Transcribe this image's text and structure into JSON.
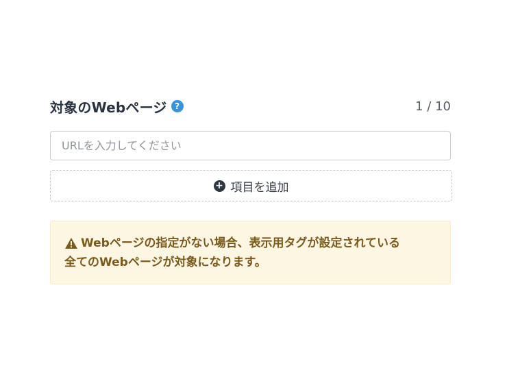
{
  "header": {
    "title": "対象のWebページ",
    "counter": "1 / 10"
  },
  "icons": {
    "help": "question-circle-icon",
    "add": "plus-circle-icon",
    "warning": "warning-triangle-icon"
  },
  "url_input": {
    "placeholder": "URLを入力してください",
    "value": ""
  },
  "add_button": {
    "label": "項目を追加"
  },
  "alert": {
    "line1": "Webページの指定がない場合、表示用タグが設定されている",
    "line2": "全てのWebページが対象になります。"
  },
  "colors": {
    "title": "#2a3440",
    "help_icon": "#3a94d9",
    "alert_bg": "#fdf6e3",
    "alert_text": "#7a5b1f"
  }
}
